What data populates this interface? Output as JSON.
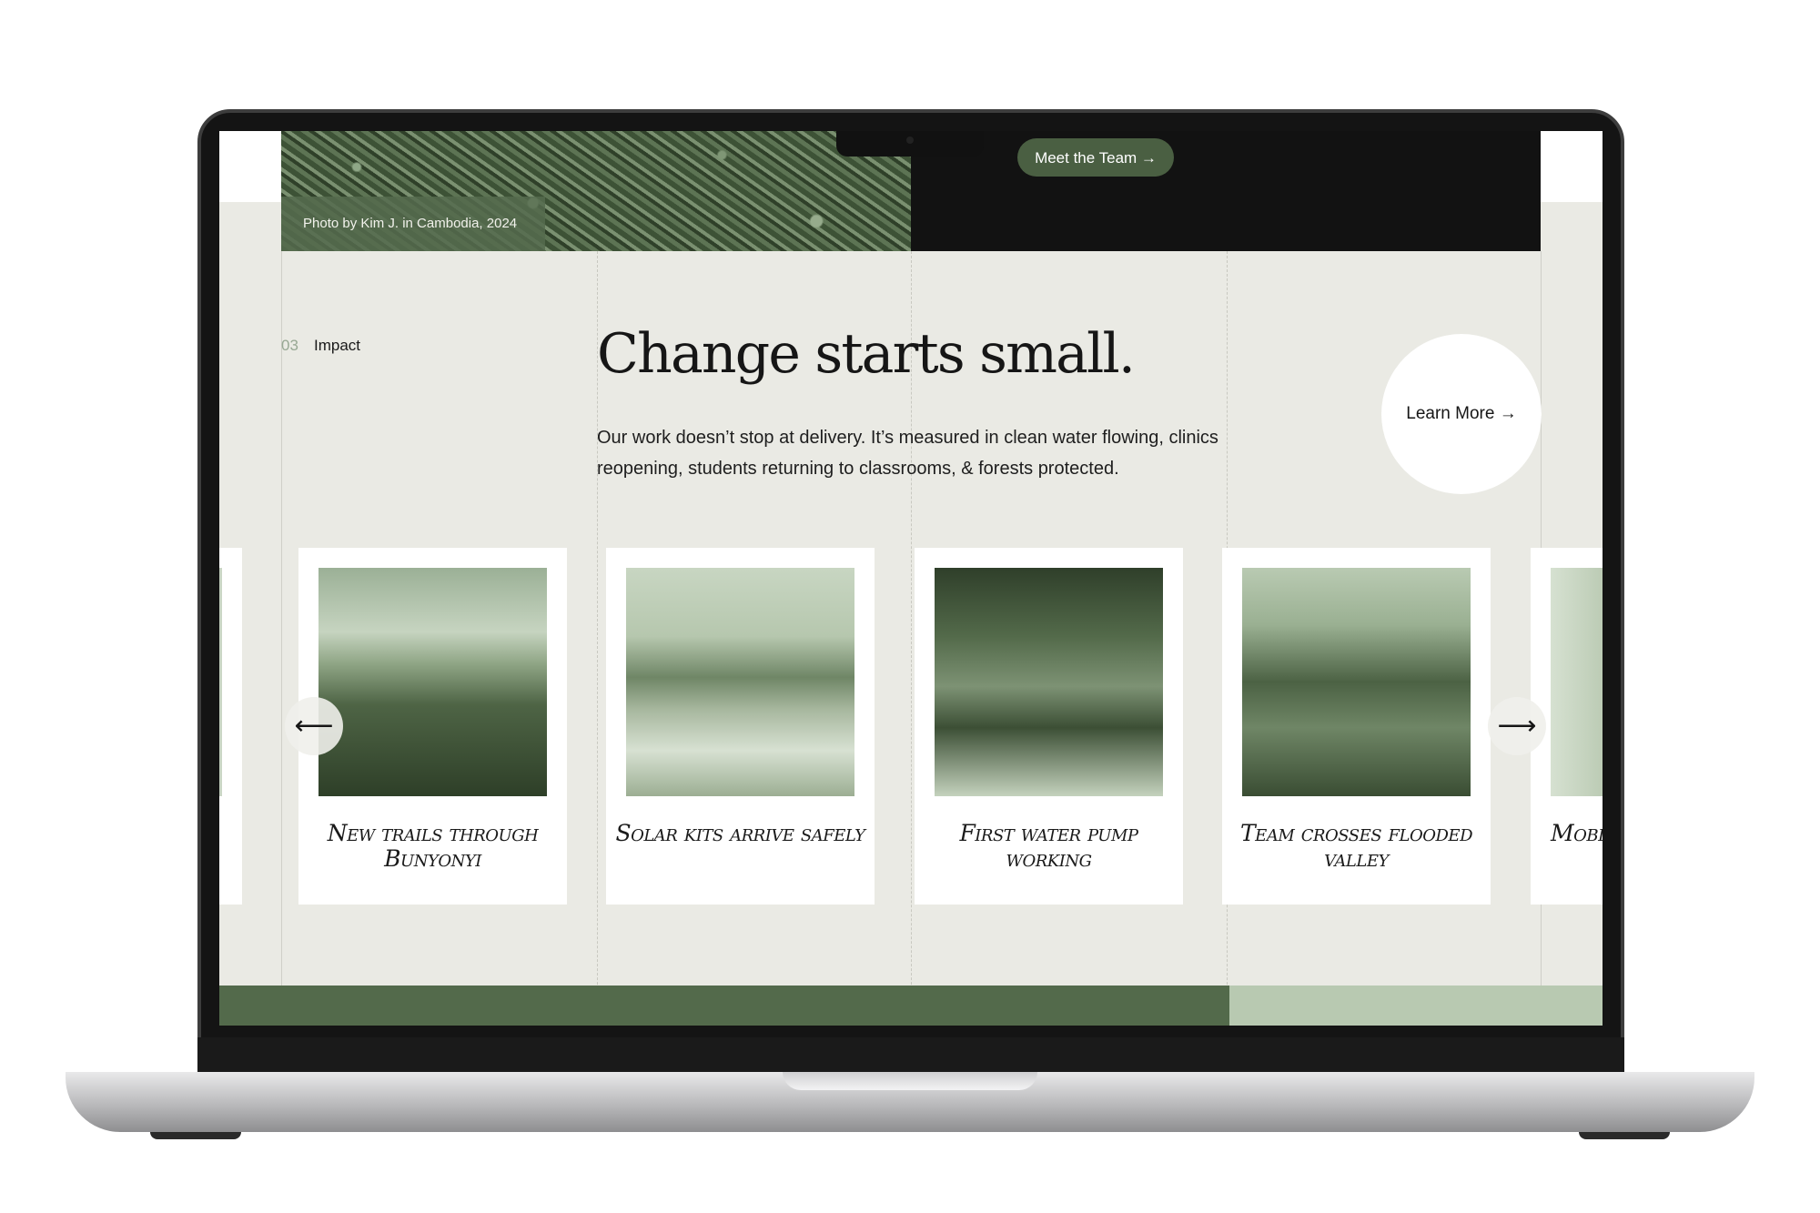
{
  "hero": {
    "photo_caption": "Photo by Kim J. in Cambodia, 2024",
    "team_button": "Meet the Team →"
  },
  "section": {
    "number": "03",
    "label": "Impact",
    "headline": "Change starts small.",
    "paragraph": "Our work doesn’t stop at delivery. It’s measured in clean water flowing, clinics reopening, students returning to classrooms, & forests protected.",
    "learn_more": "Learn More →"
  },
  "carousel": {
    "prev_arrow": "⟵",
    "next_arrow": "⟶",
    "cards": [
      {
        "caption": "New trails through Bunyonyi"
      },
      {
        "caption": "Solar kits arrive safely"
      },
      {
        "caption": "First water pump working"
      },
      {
        "caption": "Team crosses flooded valley"
      },
      {
        "caption": "Mobil"
      }
    ]
  },
  "colors": {
    "background": "#eaeae4",
    "accent_green": "#4a5f42",
    "footer_green": "#536a4b",
    "dark": "#121212"
  }
}
